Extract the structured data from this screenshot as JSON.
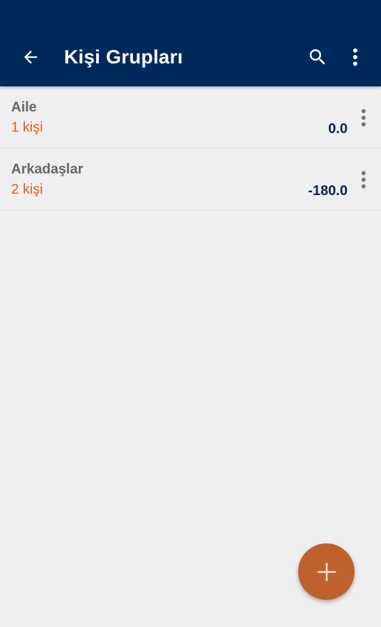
{
  "appbar": {
    "title": "Kişi Grupları",
    "back_icon": "arrow-left-icon",
    "search_icon": "search-icon",
    "overflow_icon": "more-vert-icon",
    "background": "#002a5c"
  },
  "groups": [
    {
      "name": "Aile",
      "count": "1 kişi",
      "amount": "0.0"
    },
    {
      "name": "Arkadaşlar",
      "count": "2 kişi",
      "amount": "-180.0"
    }
  ],
  "fab": {
    "icon": "plus-icon",
    "color": "#c0612d"
  },
  "colors": {
    "count_text": "#e25a2c",
    "amount_text": "#0d2447",
    "name_text": "#666666",
    "background": "#efefef"
  }
}
